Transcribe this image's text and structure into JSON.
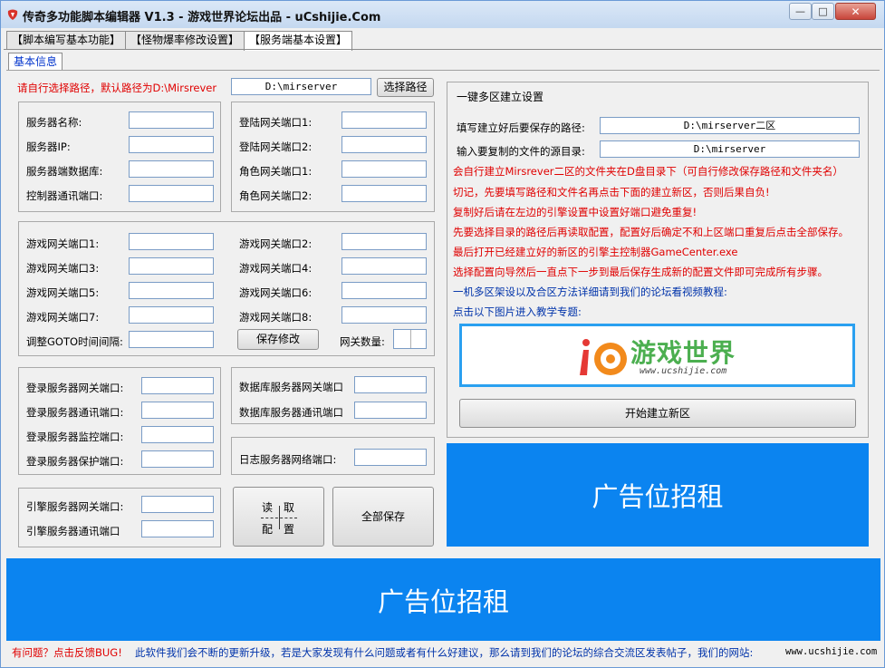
{
  "window": {
    "title": "传奇多功能脚本编辑器 V1.3 - 游戏世界论坛出品 - uCshijie.Com",
    "min_label": "0",
    "max_label": "1",
    "close_label": "r"
  },
  "tabs": [
    "【脚本编写基本功能】",
    "【怪物爆率修改设置】",
    "【服务端基本设置】"
  ],
  "subtab": "基本信息",
  "path_hint": "请自行选择路径，默认路径为D:\\Mirsrever",
  "path_value": "D:\\mirserver",
  "select_path_button": "选择路径",
  "server_box": {
    "name_label": "服务器名称:",
    "ip_label": "服务器IP:",
    "db_label": "服务器端数据库:",
    "ctrl_label": "控制器通讯端口:"
  },
  "login_gate_box": {
    "gate1": "登陆网关端口1:",
    "gate2": "登陆网关端口2:",
    "role1": "角色网关端口1:",
    "role2": "角色网关端口2:"
  },
  "game_gate_box": {
    "g1": "游戏网关端口1:",
    "g2": "游戏网关端口2:",
    "g3": "游戏网关端口3:",
    "g4": "游戏网关端口4:",
    "g5": "游戏网关端口5:",
    "g6": "游戏网关端口6:",
    "g7": "游戏网关端口7:",
    "g8": "游戏网关端口8:",
    "goto": "调整GOTO时间间隔:",
    "save": "保存修改",
    "gate_count": "网关数量:"
  },
  "login_server_box": {
    "gate": "登录服务器网关端口:",
    "comm": "登录服务器通讯端口:",
    "monitor": "登录服务器监控端口:",
    "protect": "登录服务器保护端口:"
  },
  "db_server_box": {
    "gate": "数据库服务器网关端口",
    "comm": "数据库服务器通讯端口"
  },
  "log_server_box": {
    "net": "日志服务器网络端口:"
  },
  "engine_box": {
    "gate": "引擎服务器网关端口:",
    "comm": "引擎服务器通讯端口"
  },
  "read_config": {
    "a": "读",
    "b": "取",
    "c": "配",
    "d": "置"
  },
  "save_all": "全部保存",
  "multi_zone": {
    "title": "一键多区建立设置",
    "save_path_label": "填写建立好后要保存的路径:",
    "save_path_value": "D:\\mirserver二区",
    "source_label": "输入要复制的文件的源目录:",
    "source_value": "D:\\mirserver",
    "notes_red": [
      "会自行建立Mirsrever二区的文件夹在D盘目录下（可自行修改保存路径和文件夹名）",
      "切记，先要填写路径和文件名再点击下面的建立新区，否则后果自负!",
      "复制好后请在左边的引擎设置中设置好端口避免重复!",
      "先要选择目录的路径后再读取配置，配置好后确定不和上区端口重复后点击全部保存。",
      "最后打开已经建立好的新区的引擎主控制器GameCenter.exe",
      "选择配置向导然后一直点下一步到最后保存生成新的配置文件即可完成所有步骤。"
    ],
    "note_blue1": "一机多区架设以及合区方法详细请到我们的论坛看视频教程:",
    "note_blue2": "点击以下图片进入教学专题:",
    "logo_text": "游戏世界",
    "logo_url": "www.ucshijie.com",
    "create_button": "开始建立新区"
  },
  "ad_right": "广告位招租",
  "ad_bottom": "广告位招租",
  "status": {
    "feedback": "有问题？点击反馈BUG!",
    "message": "此软件我们会不断的更新升级，若是大家发现有什么问题或者有什么好建议，那么请到我们的论坛的综合交流区发表帖子，我们的网站:",
    "site": "www.ucshijie.com"
  },
  "colors": {
    "accent_blue": "#0b84f0",
    "warn_red": "#e00000",
    "info_blue": "#0033aa"
  }
}
